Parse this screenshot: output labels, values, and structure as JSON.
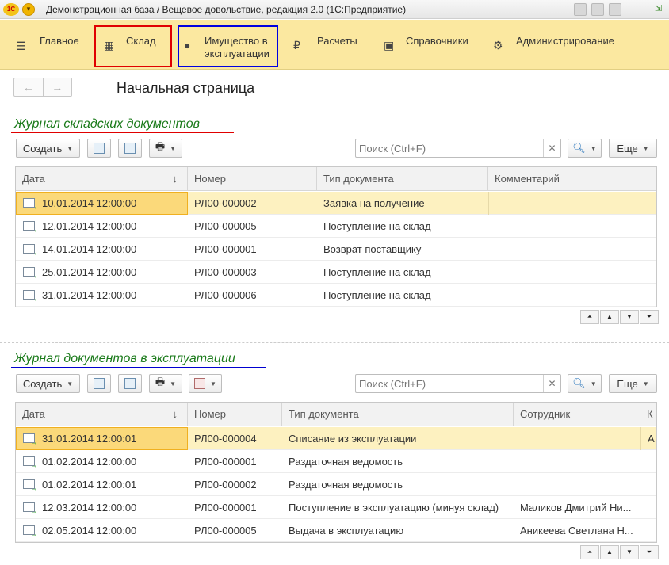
{
  "window": {
    "title": "Демонстрационная база / Вещевое довольствие, редакция 2.0  (1С:Предприятие)",
    "logo": "1С"
  },
  "sections": [
    {
      "label": "Главное",
      "icon": "hamburger-icon"
    },
    {
      "label": "Склад",
      "icon": "warehouse-grid-icon"
    },
    {
      "label": "Имущество в эксплуатации",
      "icon": "person-icon"
    },
    {
      "label": "Расчеты",
      "icon": "ruble-coin-icon"
    },
    {
      "label": "Справочники",
      "icon": "books-icon"
    },
    {
      "label": "Администрирование",
      "icon": "gear-icon"
    }
  ],
  "page": {
    "title": "Начальная страница"
  },
  "journal1": {
    "title": "Журнал складских документов",
    "create_label": "Создать",
    "search_placeholder": "Поиск (Ctrl+F)",
    "more_label": "Еще",
    "columns": [
      "Дата",
      "Номер",
      "Тип документа",
      "Комментарий"
    ],
    "sort_indicator": "↓",
    "rows": [
      {
        "date": "10.01.2014 12:00:00",
        "number": "РЛ00-000002",
        "type": "Заявка на получение",
        "comment": ""
      },
      {
        "date": "12.01.2014 12:00:00",
        "number": "РЛ00-000005",
        "type": "Поступление на склад",
        "comment": ""
      },
      {
        "date": "14.01.2014 12:00:00",
        "number": "РЛ00-000001",
        "type": "Возврат поставщику",
        "comment": ""
      },
      {
        "date": "25.01.2014 12:00:00",
        "number": "РЛ00-000003",
        "type": "Поступление на склад",
        "comment": ""
      },
      {
        "date": "31.01.2014 12:00:00",
        "number": "РЛ00-000006",
        "type": "Поступление на склад",
        "comment": ""
      }
    ]
  },
  "journal2": {
    "title": "Журнал документов в эксплуатации",
    "create_label": "Создать",
    "search_placeholder": "Поиск (Ctrl+F)",
    "more_label": "Еще",
    "columns": [
      "Дата",
      "Номер",
      "Тип документа",
      "Сотрудник",
      "К"
    ],
    "sort_indicator": "↓",
    "rows": [
      {
        "date": "31.01.2014 12:00:01",
        "number": "РЛ00-000004",
        "type": "Списание из эксплуатации",
        "employee": "",
        "extra": "А"
      },
      {
        "date": "01.02.2014 12:00:00",
        "number": "РЛ00-000001",
        "type": "Раздаточная ведомость",
        "employee": "",
        "extra": ""
      },
      {
        "date": "01.02.2014 12:00:01",
        "number": "РЛ00-000002",
        "type": "Раздаточная ведомость",
        "employee": "",
        "extra": ""
      },
      {
        "date": "12.03.2014 12:00:00",
        "number": "РЛ00-000001",
        "type": "Поступление в эксплуатацию (минуя склад)",
        "employee": "Маликов Дмитрий Ни...",
        "extra": ""
      },
      {
        "date": "02.05.2014 12:00:00",
        "number": "РЛ00-000005",
        "type": "Выдача в эксплуатацию",
        "employee": "Аникеева Светлана Н...",
        "extra": ""
      }
    ]
  },
  "colors": {
    "section_bar": "#fbe8a0",
    "selected_row": "#fdf1c0",
    "journal_title": "#1a7a1a",
    "highlight_red": "#e00000",
    "highlight_blue": "#0000e0"
  }
}
